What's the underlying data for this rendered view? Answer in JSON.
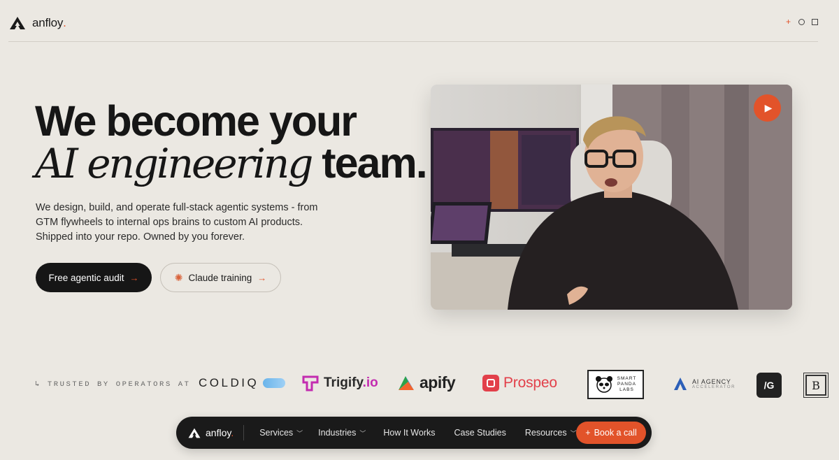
{
  "header": {
    "brand": "anfloy",
    "brand_dot": "."
  },
  "hero": {
    "title_line1": "We become your",
    "title_italic": "AI engineering",
    "title_end": " team.",
    "subtitle": "We design, build, and operate full-stack agentic systems - from GTM flywheels to internal ops brains to custom AI products. Shipped into your repo. Owned by you forever.",
    "primary_cta": "Free agentic audit",
    "secondary_cta": "Claude training",
    "arrow": "→"
  },
  "trusted": {
    "label": "↳ TRUSTED BY OPERATORS AT",
    "logos": {
      "coldiq": "COLDIQ",
      "trigify": "Trigify",
      "trigify_suffix": ".io",
      "apify": "apify",
      "prospeo": "Prospeo",
      "smartpanda": [
        "SMART",
        "PANDA",
        "LABS"
      ],
      "aiagency": "AI AGENCY",
      "aiagency_sub": "ACCELERATOR",
      "ig": "/G",
      "b": "B"
    }
  },
  "navbar": {
    "brand": "anfloy",
    "brand_dot": ".",
    "items": [
      {
        "label": "Services",
        "has_dropdown": true
      },
      {
        "label": "Industries",
        "has_dropdown": true
      },
      {
        "label": "How It Works",
        "has_dropdown": false
      },
      {
        "label": "Case Studies",
        "has_dropdown": false
      },
      {
        "label": "Resources",
        "has_dropdown": true
      }
    ],
    "cta": "Book a call",
    "cta_icon": "+"
  },
  "colors": {
    "accent": "#e2532a",
    "background": "#ebe8e2",
    "dark": "#1a1a1a"
  },
  "icons": {
    "logo": "anfloy-triangle-icon",
    "play": "play-icon",
    "chevron": "chevron-down-icon",
    "spark": "spark-icon"
  }
}
